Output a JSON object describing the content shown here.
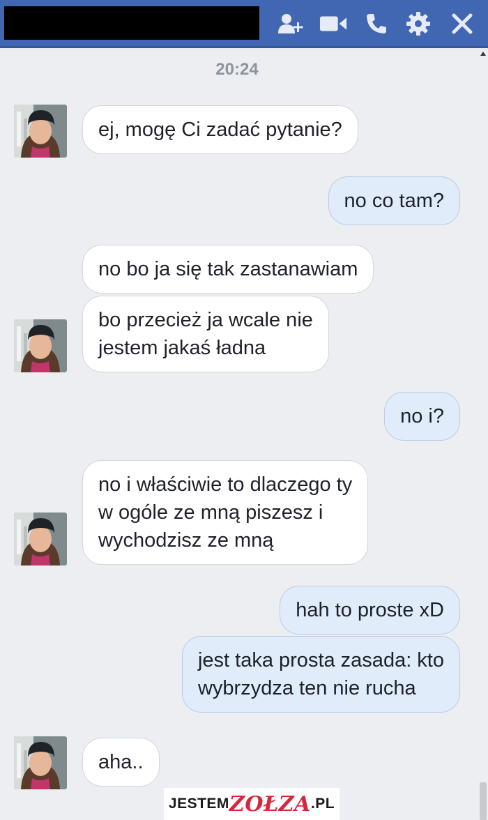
{
  "header": {
    "title_redacted": true,
    "icons": [
      "add-person-icon",
      "video-call-icon",
      "phone-icon",
      "gear-icon",
      "close-icon"
    ],
    "colors": {
      "bar": "#4267b2",
      "icon": "#e6ebf5"
    }
  },
  "chat": {
    "timestamp": "20:24",
    "messages": [
      {
        "from": "them",
        "lines": [
          "ej, mogę Ci zadać pytanie?"
        ]
      },
      {
        "from": "me",
        "lines": [
          "no co tam?"
        ]
      },
      {
        "from": "them",
        "lines": [
          "no bo ja się tak zastanawiam"
        ]
      },
      {
        "from": "them",
        "lines": [
          "bo przecież ja wcale nie",
          "jestem jakaś ładna"
        ]
      },
      {
        "from": "me",
        "lines": [
          "no i?"
        ]
      },
      {
        "from": "them",
        "lines": [
          "no i właściwie to dlaczego ty",
          "w ogóle ze mną piszesz i",
          "wychodzisz ze mną"
        ]
      },
      {
        "from": "me",
        "lines": [
          "hah to proste xD"
        ]
      },
      {
        "from": "me",
        "lines": [
          "jest taka prosta zasada: kto",
          "wybrzydza ten nie rucha"
        ]
      },
      {
        "from": "them",
        "lines": [
          "aha.."
        ]
      }
    ],
    "colors": {
      "incoming": "#ffffff",
      "outgoing": "#e1ecfb",
      "background": "#eceef2"
    }
  },
  "watermark": {
    "prefix": "JESTEM",
    "accent": "ZOŁZA",
    "suffix": ".PL"
  }
}
